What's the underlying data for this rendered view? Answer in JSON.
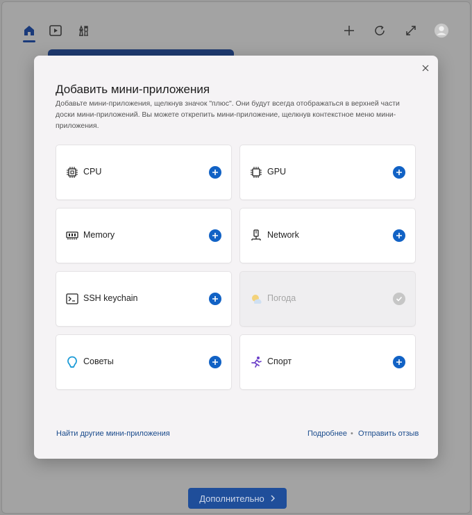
{
  "topbar": {
    "home_icon": "home-icon",
    "video_icon": "video-icon",
    "games_icon": "chess-icon",
    "add_icon": "plus-icon",
    "refresh_icon": "refresh-icon",
    "expand_icon": "expand-icon",
    "avatar_icon": "user-avatar-icon"
  },
  "background": {
    "more_button_label": "Дополнительно"
  },
  "dialog": {
    "title": "Добавить мини-приложения",
    "description": "Добавьте мини-приложения, щелкнув значок \"плюс\". Они будут всегда отображаться в верхней части доски мини-приложений. Вы можете открепить мини-приложение, щелкнув контекстное меню мини-приложения.",
    "widgets": [
      {
        "label": "CPU",
        "icon": "cpu-icon",
        "added": false
      },
      {
        "label": "GPU",
        "icon": "gpu-chip-icon",
        "added": false
      },
      {
        "label": "Memory",
        "icon": "memory-icon",
        "added": false
      },
      {
        "label": "Network",
        "icon": "network-icon",
        "added": false
      },
      {
        "label": "SSH keychain",
        "icon": "terminal-icon",
        "added": false
      },
      {
        "label": "Погода",
        "icon": "weather-icon",
        "added": true
      },
      {
        "label": "Советы",
        "icon": "tips-icon",
        "added": false
      },
      {
        "label": "Спорт",
        "icon": "sport-icon",
        "added": false
      }
    ],
    "footer": {
      "find_more": "Найти другие мини-приложения",
      "learn_more": "Подробнее",
      "feedback": "Отправить отзыв"
    }
  },
  "colors": {
    "accent": "#1162c5",
    "link": "#1a4b8c"
  }
}
